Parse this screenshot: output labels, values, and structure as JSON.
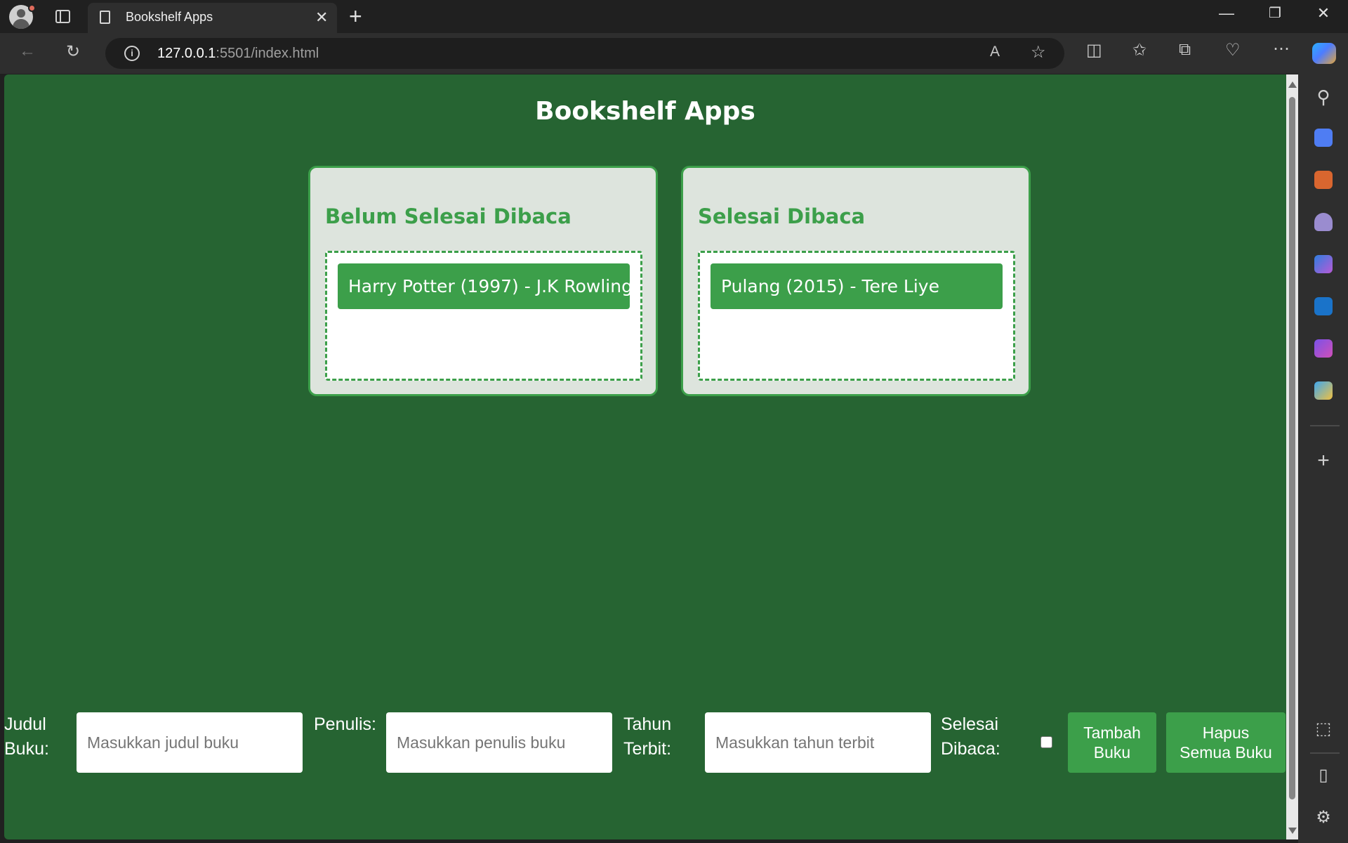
{
  "browser": {
    "tab_title": "Bookshelf Apps",
    "tab_close": "✕",
    "new_tab": "+",
    "url_host": "127.0.0.1",
    "url_rest": ":5501/index.html",
    "window_controls": {
      "minimize": "—",
      "restore": "❐",
      "close": "✕"
    },
    "toolbar_icons": [
      "back-icon",
      "refresh-icon",
      "read-aloud-icon",
      "favorite-icon",
      "split-screen-icon",
      "favorites-icon",
      "collections-icon",
      "browser-essentials-icon",
      "more-icon",
      "copilot-icon"
    ],
    "sidebar_icons": [
      "search-icon",
      "shopping-icon",
      "tools-icon",
      "games-icon",
      "microsoft365-icon",
      "outlook-icon",
      "designer-icon",
      "telegram-icon",
      "add-icon",
      "screenshot-icon",
      "sidebar-toggle-icon",
      "settings-icon"
    ]
  },
  "app": {
    "title": "Bookshelf Apps",
    "shelves": [
      {
        "title": "Belum Selesai Dibaca",
        "books": [
          "Harry Potter (1997) - J.K Rowling"
        ]
      },
      {
        "title": "Selesai Dibaca",
        "books": [
          "Pulang (2015) - Tere Liye"
        ]
      }
    ],
    "form": {
      "title_label_1": "Judul",
      "title_label_2": "Buku:",
      "title_placeholder": "Masukkan judul buku",
      "author_label": "Penulis:",
      "author_placeholder": "Masukkan penulis buku",
      "year_label_1": "Tahun",
      "year_label_2": "Terbit:",
      "year_placeholder": "Masukkan tahun terbit",
      "done_label_1": "Selesai",
      "done_label_2": "Dibaca:",
      "done_checked": false,
      "add_button_1": "Tambah",
      "add_button_2": "Buku",
      "clear_button_1": "Hapus",
      "clear_button_2": "Semua Buku"
    }
  },
  "colors": {
    "page_bg": "#266432",
    "accent": "#3c9f4a",
    "shelf_bg": "#dde4dd"
  }
}
